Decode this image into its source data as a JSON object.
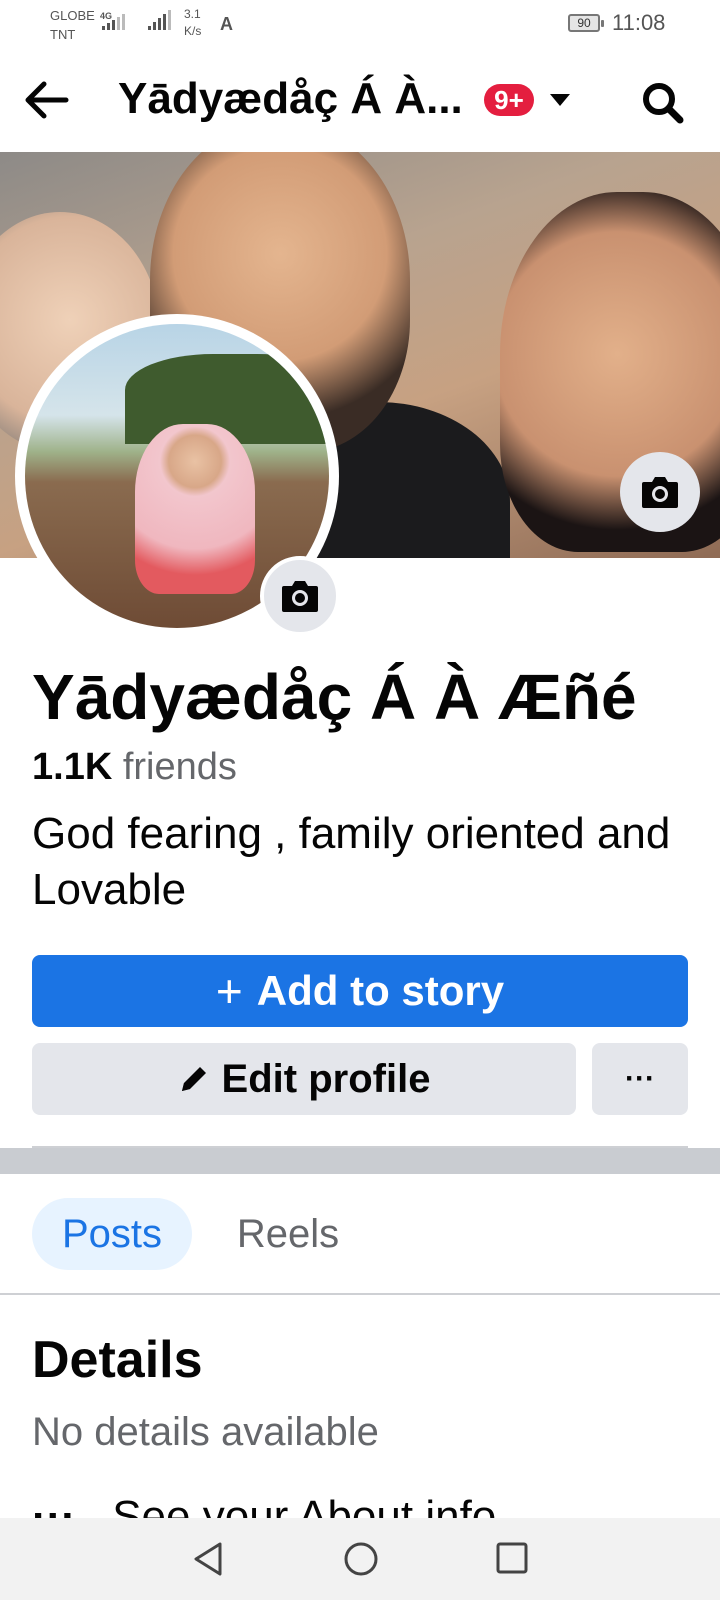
{
  "status_bar": {
    "carrier_line1": "GLOBE",
    "carrier_line2": "TNT",
    "network_type": "4G",
    "speed_value": "3.1",
    "speed_unit": "K/s",
    "battery": "90",
    "time": "11:08"
  },
  "topbar": {
    "back_icon": "arrow-left-icon",
    "title": "Yādyædåç Á À...",
    "notification_badge": "9+",
    "search_icon": "search-icon"
  },
  "profile": {
    "name": "Yādyædåç Á À Æñé",
    "friends_count": "1.1K",
    "friends_label": "friends",
    "bio": "God fearing , family oriented and Lovable"
  },
  "actions": {
    "add_story_icon": "+",
    "add_story_label": "Add to story",
    "edit_profile_label": "Edit profile",
    "more_label": "···"
  },
  "tabs": [
    {
      "label": "Posts",
      "selected": true
    },
    {
      "label": "Reels",
      "selected": false
    }
  ],
  "details": {
    "title": "Details",
    "empty_text": "No details available",
    "about_dots": "···",
    "about_link": "See your About info"
  },
  "colors": {
    "accent": "#1b74e4",
    "badge": "#e41e3f",
    "button_gray": "#e4e6eb"
  }
}
